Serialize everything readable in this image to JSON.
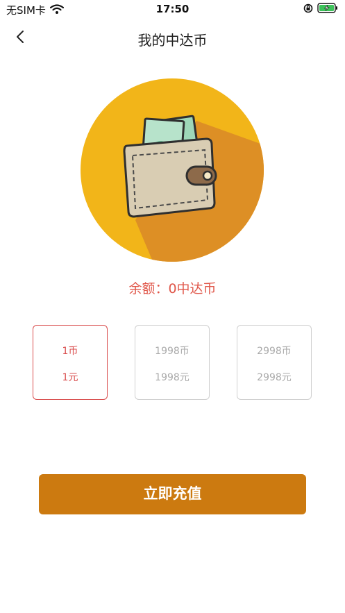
{
  "status": {
    "carrier": "无SIM卡",
    "time": "17:50"
  },
  "nav": {
    "title": "我的中达币"
  },
  "balance": {
    "text": "余额：0中达币"
  },
  "options": [
    {
      "coins": "1币",
      "price": "1元",
      "selected": true
    },
    {
      "coins": "1998币",
      "price": "1998元",
      "selected": false
    },
    {
      "coins": "2998币",
      "price": "2998元",
      "selected": false
    }
  ],
  "colors": {
    "accent": "#d94c4c",
    "button": "#cc7a10",
    "circle": "#f2b519",
    "shadow": "#dd8f25"
  },
  "recharge_button": {
    "label": "立即充值"
  }
}
